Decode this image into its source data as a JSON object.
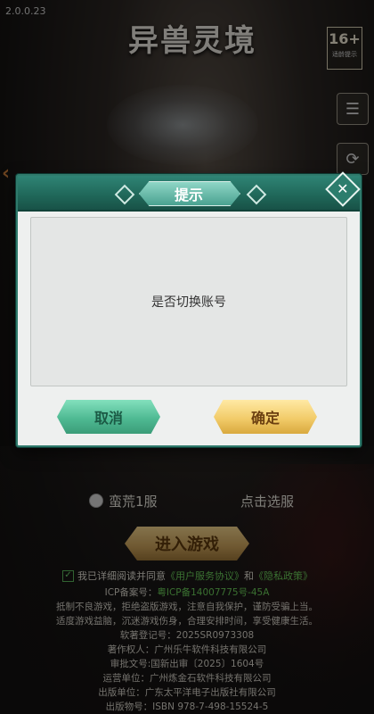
{
  "version": "2.0.0.23",
  "logo": "异兽灵境",
  "age_rating": {
    "number": "16+",
    "note": "适龄提示"
  },
  "side_icons": [
    "notice-icon",
    "refresh-icon"
  ],
  "dialog": {
    "title": "提示",
    "message": "是否切换账号",
    "cancel_label": "取消",
    "ok_label": "确定",
    "close_icon": "close-icon"
  },
  "server": {
    "name": "蛮荒1服",
    "select_label": "点击选服"
  },
  "enter_label": "进入游戏",
  "agreement": {
    "prefix": "我已详细阅读并同意",
    "terms": "《用户服务协议》",
    "and": "和",
    "privacy": "《隐私政策》"
  },
  "icp": {
    "label": "ICP备案号：",
    "value": "粤ICP备14007775号-45A"
  },
  "notice_lines": [
    "抵制不良游戏，拒绝盗版游戏，注意自我保护，谨防受骗上当。",
    "适度游戏益脑，沉迷游戏伤身，合理安排时间，享受健康生活。"
  ],
  "credits": [
    "软著登记号：2025SR0973308",
    "著作权人：广州乐牛软件科技有限公司",
    "审批文号:国新出审〔2025〕1604号",
    "运营单位：广州炼金石软件科技有限公司",
    "出版单位：广东太平洋电子出版社有限公司",
    "出版物号：ISBN  978-7-498-15524-5"
  ],
  "colors": {
    "dialog_header": "#1f6658",
    "cancel": "#4fba93",
    "ok": "#f2cc6a",
    "link": "#6acc5a"
  }
}
